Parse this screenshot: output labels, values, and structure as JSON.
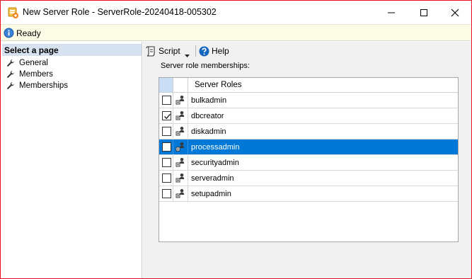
{
  "window": {
    "title": "New Server Role - ServerRole-20240418-005302",
    "icons": {
      "app": "server-role-icon",
      "minimize": "minimize-icon",
      "maximize": "maximize-icon",
      "close": "close-icon"
    }
  },
  "status": {
    "text": "Ready",
    "icon": "info-icon"
  },
  "sidebar": {
    "header": "Select a page",
    "items": [
      {
        "label": "General",
        "icon": "wrench-icon"
      },
      {
        "label": "Members",
        "icon": "wrench-icon"
      },
      {
        "label": "Memberships",
        "icon": "wrench-icon"
      }
    ]
  },
  "toolbar": {
    "script_label": "Script",
    "help_label": "Help"
  },
  "main": {
    "section_label": "Server role memberships:",
    "table": {
      "columns": [
        "",
        "",
        "Server Roles"
      ],
      "rows": [
        {
          "name": "bulkadmin",
          "checked": false,
          "selected": false
        },
        {
          "name": "dbcreator",
          "checked": true,
          "selected": false
        },
        {
          "name": "diskadmin",
          "checked": false,
          "selected": false
        },
        {
          "name": "processadmin",
          "checked": false,
          "selected": true
        },
        {
          "name": "securityadmin",
          "checked": false,
          "selected": false
        },
        {
          "name": "serveradmin",
          "checked": false,
          "selected": false
        },
        {
          "name": "setupadmin",
          "checked": false,
          "selected": false
        }
      ]
    }
  },
  "colors": {
    "selection": "#0078d7",
    "status_bg": "#fcfce6",
    "sidebar_header_bg": "#d6e2f0",
    "border_accent": "#e81123"
  }
}
